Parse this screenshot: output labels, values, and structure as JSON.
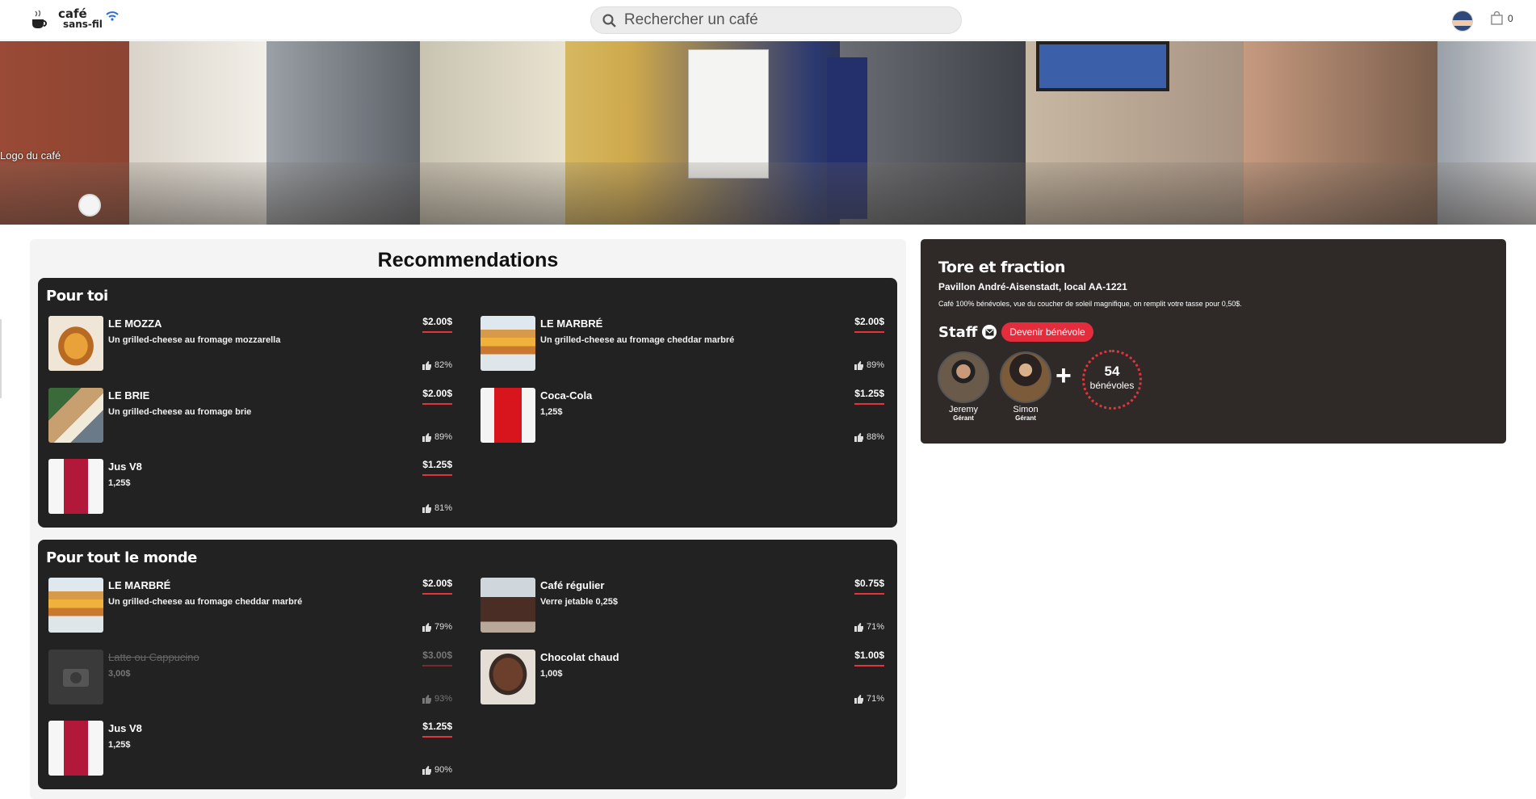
{
  "brand": {
    "line1": "café",
    "line2": "sans-fil"
  },
  "search": {
    "placeholder": "Rechercher un café"
  },
  "cart": {
    "count": "0"
  },
  "hero": {
    "logo_alt": "Logo du café"
  },
  "recommendations": {
    "title": "Recommendations",
    "groups": [
      {
        "title": "Pour toi",
        "items": [
          {
            "name": "LE MOZZA",
            "desc": "Un grilled-cheese au fromage mozzarella",
            "price": "$2.00$",
            "rating": "82%",
            "image": "grilled-cheese"
          },
          {
            "name": "LE MARBRÉ",
            "desc": "Un grilled-cheese au fromage cheddar marbré",
            "price": "$2.00$",
            "rating": "89%",
            "image": "grilled-cheese-marbre"
          },
          {
            "name": "LE BRIE",
            "desc": "Un grilled-cheese au fromage brie",
            "price": "$2.00$",
            "rating": "89%",
            "image": "grilled-cheese-brie"
          },
          {
            "name": "Coca-Cola",
            "desc": "1,25$",
            "price": "$1.25$",
            "rating": "88%",
            "image": "coca-cola-can"
          },
          {
            "name": "Jus V8",
            "desc": "1,25$",
            "price": "$1.25$",
            "rating": "81%",
            "image": "v8-bottle"
          }
        ]
      },
      {
        "title": "Pour tout le monde",
        "items": [
          {
            "name": "LE MARBRÉ",
            "desc": "Un grilled-cheese au fromage cheddar marbré",
            "price": "$2.00$",
            "rating": "79%",
            "image": "grilled-cheese-marbre"
          },
          {
            "name": "Café régulier",
            "desc": "Verre jetable 0,25$",
            "price": "$0.75$",
            "rating": "71%",
            "image": "coffee"
          },
          {
            "name": "Latte ou Cappucino",
            "desc": "3,00$",
            "price": "$3.00$",
            "rating": "93%",
            "image": "camera-placeholder",
            "disabled": true
          },
          {
            "name": "Chocolat chaud",
            "desc": "1,00$",
            "price": "$1.00$",
            "rating": "71%",
            "image": "hot-chocolate"
          },
          {
            "name": "Jus V8",
            "desc": "1,25$",
            "price": "$1.25$",
            "rating": "90%",
            "image": "v8-bottle"
          }
        ]
      }
    ]
  },
  "cafe": {
    "name": "Tore et fraction",
    "location": "Pavillon André-Aisenstadt, local AA-1221",
    "description": "Café 100% bénévoles, vue du coucher de soleil magnifique, on remplit votre tasse pour 0,50$.",
    "staff_label": "Staff",
    "volunteer_button": "Devenir bénévole",
    "members": [
      {
        "name": "Jeremy",
        "role": "Gérant"
      },
      {
        "name": "Simon",
        "role": "Gérant"
      }
    ],
    "plus": "+",
    "volunteers_count": "54",
    "volunteers_label": "bénévoles"
  },
  "colors": {
    "accent": "#e52c3c",
    "panel_dark": "#222223",
    "card_dark": "#2f2a28"
  }
}
